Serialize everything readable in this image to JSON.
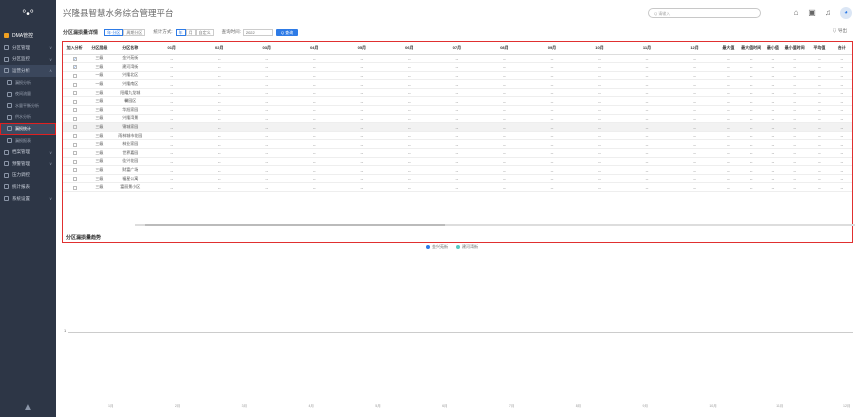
{
  "sidebar": {
    "logo": "°•°",
    "top_item": "DMA管控",
    "items": [
      {
        "label": "分区管理",
        "type": "group",
        "chev": "∨"
      },
      {
        "label": "分区监控",
        "type": "group",
        "chev": "∨"
      },
      {
        "label": "运营分析",
        "type": "group-open",
        "chev": "∧"
      },
      {
        "label": "漏损分析",
        "type": "sub"
      },
      {
        "label": "夜间流量",
        "type": "sub"
      },
      {
        "label": "水量平衡分析",
        "type": "sub"
      },
      {
        "label": "供水分析",
        "type": "sub"
      },
      {
        "label": "漏损统计",
        "type": "sub-active"
      },
      {
        "label": "漏损报表",
        "type": "sub"
      },
      {
        "label": "档案管理",
        "type": "group",
        "chev": "∨"
      },
      {
        "label": "预警管理",
        "type": "group",
        "chev": "∨"
      },
      {
        "label": "压力调控",
        "type": "group"
      },
      {
        "label": "统计报表",
        "type": "group"
      },
      {
        "label": "系统设置",
        "type": "group",
        "chev": "∨"
      }
    ],
    "footer": "▲"
  },
  "topbar": {
    "title": "兴隆县智慧水务综合管理平台",
    "search_placeholder": "Q 请输入",
    "home_icon": "⌂",
    "screen_icon": "▣",
    "bell_icon": "♫",
    "avatar": "◕"
  },
  "toolbar": {
    "section_label": "分区漏损量详情",
    "chips": [
      "年·分区",
      "周期分区"
    ],
    "stat_label": "统计方式:",
    "stat_options": [
      "年",
      "月",
      "自定义"
    ],
    "query_label": "查询时间:",
    "query_value": "2022",
    "query_button": "Q 查询",
    "export_label": "⇩ 导出"
  },
  "table": {
    "headers": [
      "加入分析",
      "分区层级",
      "分区名称",
      "01月",
      "02月",
      "03月",
      "04月",
      "05月",
      "06月",
      "07月",
      "08月",
      "09月",
      "10月",
      "11月",
      "12月",
      "最大值",
      "最大值时间",
      "最小值",
      "最小值时间",
      "平均值",
      "合计"
    ],
    "rows": [
      {
        "checked": true,
        "level": "三级",
        "name": "金兴苑街",
        "alt": false
      },
      {
        "checked": true,
        "level": "三级",
        "name": "建河湾街",
        "alt": false
      },
      {
        "checked": false,
        "level": "一级",
        "name": "兴隆北区",
        "alt": false
      },
      {
        "checked": false,
        "level": "一级",
        "name": "兴隆南区",
        "alt": false
      },
      {
        "checked": false,
        "level": "三级",
        "name": "阳耀九龙城",
        "alt": false
      },
      {
        "checked": false,
        "level": "三级",
        "name": "馨园区",
        "alt": false
      },
      {
        "checked": false,
        "level": "三级",
        "name": "华旭家园",
        "alt": false
      },
      {
        "checked": false,
        "level": "三级",
        "name": "兴隆湾景",
        "alt": false
      },
      {
        "checked": false,
        "level": "三级",
        "name": "锦城家园",
        "alt": true
      },
      {
        "checked": false,
        "level": "三级",
        "name": "雨林城市花园",
        "alt": false
      },
      {
        "checked": false,
        "level": "三级",
        "name": "林业家园",
        "alt": false
      },
      {
        "checked": false,
        "level": "三级",
        "name": "世界嘉园",
        "alt": false
      },
      {
        "checked": false,
        "level": "三级",
        "name": "佳兴花园",
        "alt": false
      },
      {
        "checked": false,
        "level": "三级",
        "name": "财富广场",
        "alt": false
      },
      {
        "checked": false,
        "level": "三级",
        "name": "福星公寓",
        "alt": false
      },
      {
        "checked": false,
        "level": "三级",
        "name": "富丽景小区",
        "alt": false
      }
    ],
    "empty": "--"
  },
  "panel_footer": "分区漏损量趋势",
  "chart_data": {
    "type": "line",
    "legend": [
      {
        "name": "金兴苑街",
        "color": "#2e7be6"
      },
      {
        "name": "建河湾街",
        "color": "#58c9c2"
      }
    ],
    "y_tick": "1",
    "x": [
      "1月",
      "2月",
      "3月",
      "4月",
      "5月",
      "6月",
      "7月",
      "8月",
      "9月",
      "10月",
      "11月",
      "12月"
    ]
  }
}
